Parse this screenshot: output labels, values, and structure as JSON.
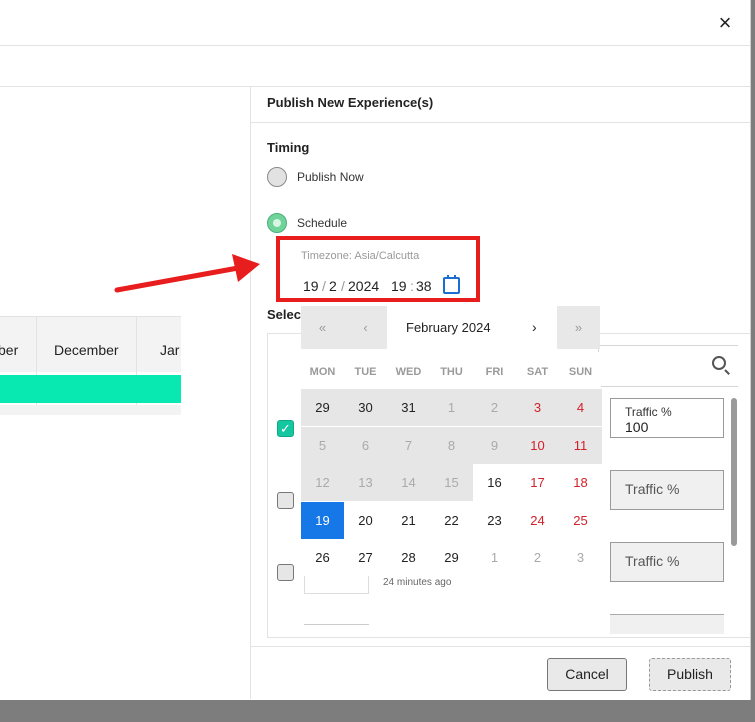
{
  "modal": {
    "close_label": "×"
  },
  "timeline": {
    "months": [
      "ber",
      "December",
      "Jar"
    ]
  },
  "panel": {
    "title": "Publish New Experience(s)",
    "timing_label": "Timing",
    "publish_now_label": "Publish Now",
    "schedule_label": "Schedule",
    "selected_option": "Schedule",
    "timezone_label": "Timezone: Asia/Calcutta",
    "datetime": {
      "day": "19",
      "month": "2",
      "year": "2024",
      "hour": "19",
      "minute": "38"
    },
    "select_label": "Selec"
  },
  "calendar": {
    "month_label": "February 2024",
    "prev_year": "«",
    "prev_month": "‹",
    "next_month": "›",
    "next_year": "»",
    "weekdays": [
      "MON",
      "TUE",
      "WED",
      "THU",
      "FRI",
      "SAT",
      "SUN"
    ],
    "weeks": [
      [
        "29",
        "30",
        "31",
        "1",
        "2",
        "3",
        "4"
      ],
      [
        "5",
        "6",
        "7",
        "8",
        "9",
        "10",
        "11"
      ],
      [
        "12",
        "13",
        "14",
        "15",
        "16",
        "17",
        "18"
      ],
      [
        "19",
        "20",
        "21",
        "22",
        "23",
        "24",
        "25"
      ],
      [
        "26",
        "27",
        "28",
        "29",
        "1",
        "2",
        "3"
      ]
    ],
    "selected_day": "19"
  },
  "experiences": {
    "rows": [
      {
        "checked": true,
        "traffic_label": "Traffic %",
        "traffic_value": "100"
      },
      {
        "checked": false,
        "traffic_placeholder": "Traffic %"
      },
      {
        "checked": false,
        "traffic_placeholder": "Traffic %"
      }
    ],
    "time_ago": "24 minutes ago"
  },
  "footer": {
    "cancel_label": "Cancel",
    "publish_label": "Publish"
  },
  "colors": {
    "highlight_box": "#e81d1d",
    "selected_day": "#1677e6",
    "timeline_bar": "#08e8b1",
    "weekend": "#d3202a"
  }
}
